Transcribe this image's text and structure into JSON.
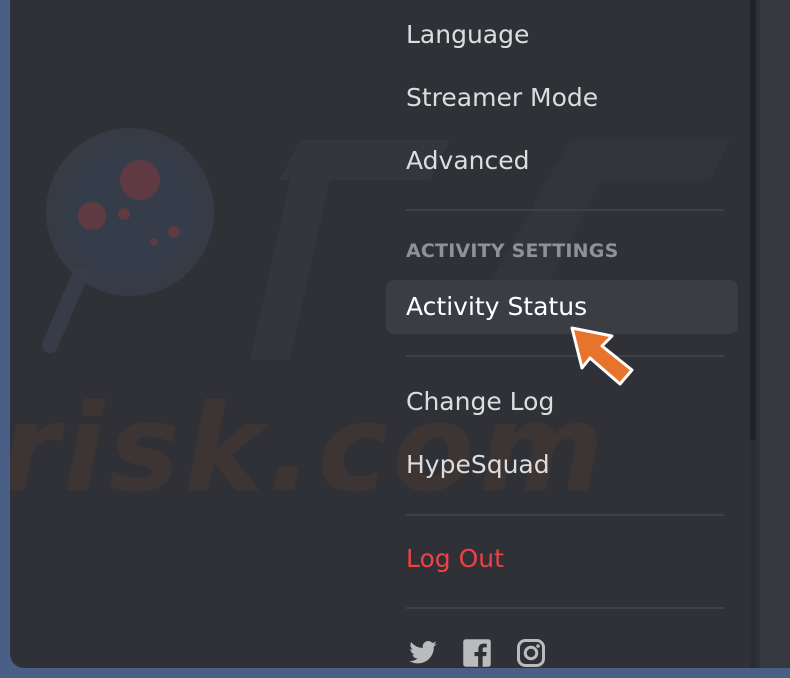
{
  "nav": {
    "items": [
      {
        "label": "Language"
      },
      {
        "label": "Streamer Mode"
      },
      {
        "label": "Advanced"
      },
      {
        "label": "Activity Status"
      },
      {
        "label": "Change Log"
      },
      {
        "label": "HypeSquad"
      },
      {
        "label": "Log Out"
      }
    ],
    "section_header": "ACTIVITY SETTINGS",
    "active_item": "Activity Status"
  },
  "socials": {
    "icons": [
      "twitter-icon",
      "facebook-icon",
      "instagram-icon"
    ]
  },
  "watermark": {
    "text": "risk.com"
  },
  "colors": {
    "sidebar_bg": "#2f3136",
    "text": "#dcddde",
    "header": "#8e9297",
    "danger": "#ed4245",
    "active_bg": "#3a3d44",
    "cursor": "#e8742b"
  }
}
